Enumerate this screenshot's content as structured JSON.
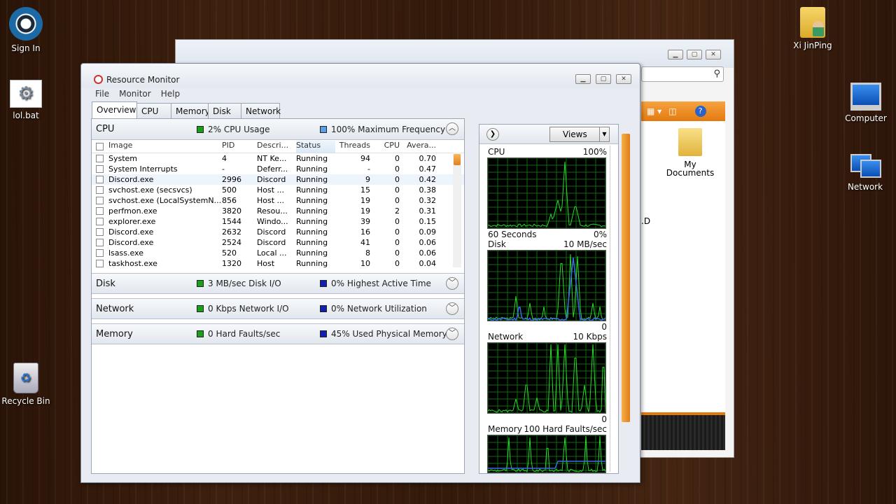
{
  "desktop": {
    "left_icons": [
      {
        "label": "Sign In"
      },
      {
        "label": "lol.bat"
      },
      {
        "label": "Recycle Bin"
      }
    ],
    "right_icons": [
      {
        "label": "Xi JinPing"
      },
      {
        "label": "Computer"
      },
      {
        "label": "Network"
      }
    ]
  },
  "bg_window": {
    "item_label": "My Documents",
    "partial_text": ".D"
  },
  "window": {
    "title": "Resource Monitor",
    "menu": [
      "File",
      "Monitor",
      "Help"
    ],
    "tabs": [
      "Overview",
      "CPU",
      "Memory",
      "Disk",
      "Network"
    ]
  },
  "cpu_section": {
    "name": "CPU",
    "stat1": "2% CPU Usage",
    "stat2": "100% Maximum Frequency",
    "columns": [
      "Image",
      "PID",
      "Descri...",
      "Status",
      "Threads",
      "CPU",
      "Avera..."
    ],
    "rows": [
      {
        "image": "System",
        "pid": "4",
        "desc": "NT Ke...",
        "status": "Running",
        "threads": "94",
        "cpu": "0",
        "avg": "0.70"
      },
      {
        "image": "System Interrupts",
        "pid": "-",
        "desc": "Deferr...",
        "status": "Running",
        "threads": "-",
        "cpu": "0",
        "avg": "0.47"
      },
      {
        "image": "Discord.exe",
        "pid": "2996",
        "desc": "Discord",
        "status": "Running",
        "threads": "9",
        "cpu": "0",
        "avg": "0.42"
      },
      {
        "image": "svchost.exe (secsvcs)",
        "pid": "500",
        "desc": "Host ...",
        "status": "Running",
        "threads": "15",
        "cpu": "0",
        "avg": "0.38"
      },
      {
        "image": "svchost.exe (LocalSystemN...",
        "pid": "856",
        "desc": "Host ...",
        "status": "Running",
        "threads": "19",
        "cpu": "0",
        "avg": "0.32"
      },
      {
        "image": "perfmon.exe",
        "pid": "3820",
        "desc": "Resou...",
        "status": "Running",
        "threads": "19",
        "cpu": "2",
        "avg": "0.31"
      },
      {
        "image": "explorer.exe",
        "pid": "1544",
        "desc": "Windo...",
        "status": "Running",
        "threads": "39",
        "cpu": "0",
        "avg": "0.15"
      },
      {
        "image": "Discord.exe",
        "pid": "2632",
        "desc": "Discord",
        "status": "Running",
        "threads": "16",
        "cpu": "0",
        "avg": "0.09"
      },
      {
        "image": "Discord.exe",
        "pid": "2524",
        "desc": "Discord",
        "status": "Running",
        "threads": "41",
        "cpu": "0",
        "avg": "0.06"
      },
      {
        "image": "lsass.exe",
        "pid": "520",
        "desc": "Local ...",
        "status": "Running",
        "threads": "8",
        "cpu": "0",
        "avg": "0.06"
      },
      {
        "image": "taskhost.exe",
        "pid": "1320",
        "desc": "Host",
        "status": "Running",
        "threads": "10",
        "cpu": "0",
        "avg": "0.04"
      }
    ]
  },
  "disk_section": {
    "name": "Disk",
    "stat1": "3 MB/sec Disk I/O",
    "stat2": "0% Highest Active Time"
  },
  "network_section": {
    "name": "Network",
    "stat1": "0 Kbps Network I/O",
    "stat2": "0% Network Utilization"
  },
  "memory_section": {
    "name": "Memory",
    "stat1": "0 Hard Faults/sec",
    "stat2": "45% Used Physical Memory"
  },
  "right_panel": {
    "views_label": "Views",
    "graphs": [
      {
        "name": "CPU",
        "max": "100%",
        "foot_left": "60 Seconds",
        "foot_right": "0%"
      },
      {
        "name": "Disk",
        "max": "10 MB/sec",
        "foot_left": "",
        "foot_right": "0"
      },
      {
        "name": "Network",
        "max": "10 Kbps",
        "foot_left": "",
        "foot_right": "0"
      },
      {
        "name": "Memory",
        "max": "100 Hard Faults/sec",
        "foot_left": "",
        "foot_right": ""
      }
    ]
  },
  "colors": {
    "graph_line": "#2bd82b",
    "graph_grid": "#0b6b0b",
    "accent_orange": "#e37a10"
  }
}
